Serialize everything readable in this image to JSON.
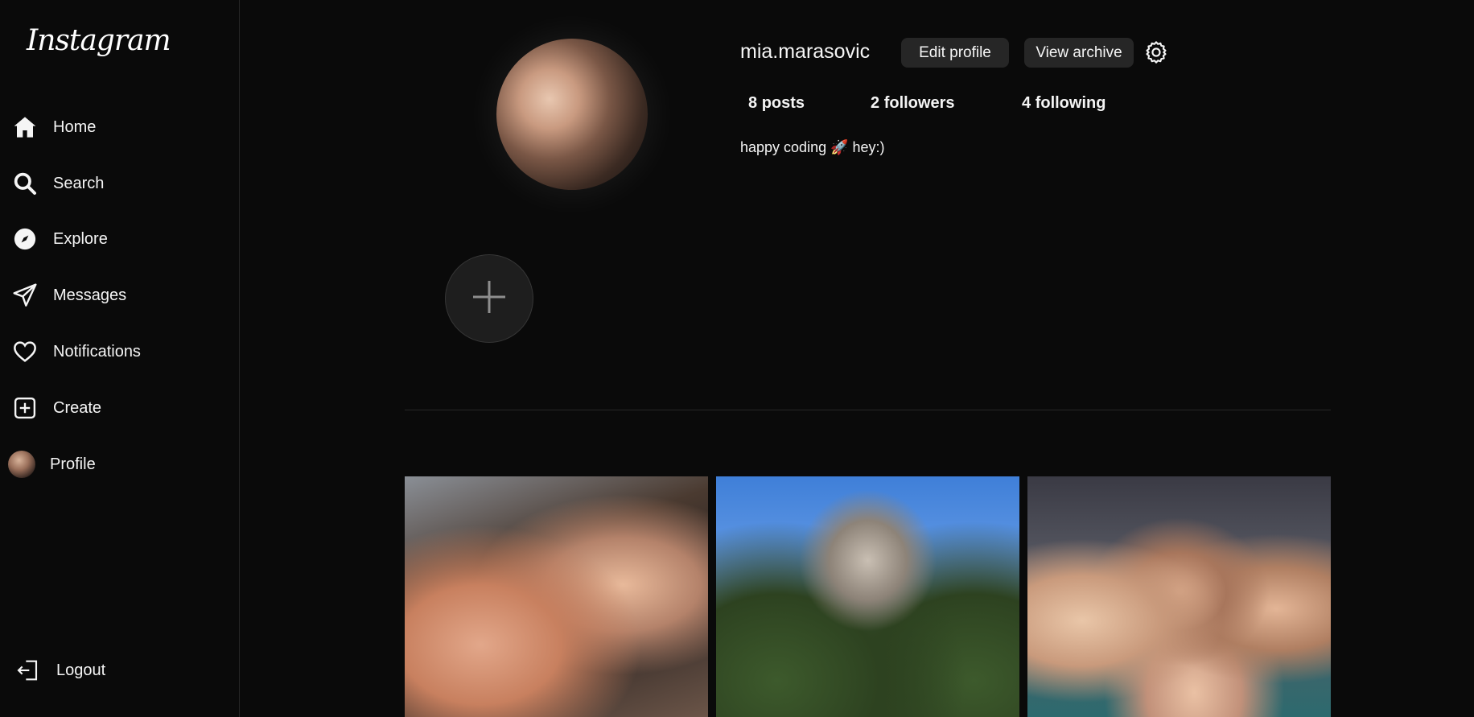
{
  "sidebar": {
    "logo": "Instagram",
    "items": [
      {
        "label": "Home",
        "icon": "home-icon"
      },
      {
        "label": "Search",
        "icon": "search-icon"
      },
      {
        "label": "Explore",
        "icon": "compass-icon"
      },
      {
        "label": "Messages",
        "icon": "paper-plane-icon"
      },
      {
        "label": "Notifications",
        "icon": "heart-icon"
      },
      {
        "label": "Create",
        "icon": "plus-square-icon"
      },
      {
        "label": "Profile",
        "icon": "avatar"
      }
    ],
    "logout": {
      "label": "Logout",
      "icon": "logout-icon"
    }
  },
  "profile": {
    "username": "mia.marasovic",
    "edit_label": "Edit profile",
    "archive_label": "View archive",
    "stats": {
      "posts": "8",
      "posts_label": "posts",
      "followers": "2",
      "followers_label": "followers",
      "following": "4",
      "following_label": "following"
    },
    "bio": "happy coding 🚀 hey:)"
  },
  "colors": {
    "background": "#0a0a0a",
    "button": "#262626",
    "text": "#f5f5f5",
    "divider": "#262626"
  }
}
